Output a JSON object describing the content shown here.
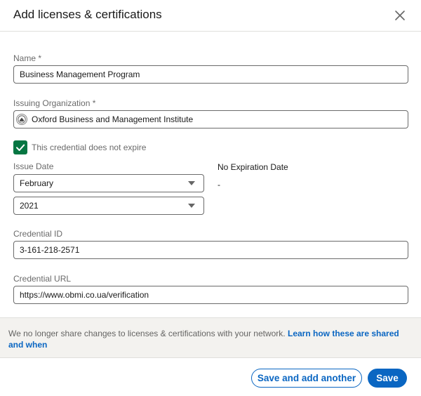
{
  "dialog": {
    "title": "Add licenses & certifications",
    "close_icon": "close-icon"
  },
  "form": {
    "name": {
      "label": "Name *",
      "value": "Business Management Program"
    },
    "issuing_org": {
      "label": "Issuing Organization *",
      "value": "Oxford Business and Management Institute",
      "logo_icon": "organization-logo-icon"
    },
    "no_expire": {
      "label": "This credential does not expire",
      "checked": true
    },
    "issue_date": {
      "label": "Issue Date",
      "month": "February",
      "year": "2021"
    },
    "expiration": {
      "label": "No Expiration Date",
      "value": "-"
    },
    "credential_id": {
      "label": "Credential ID",
      "value": "3-161-218-2571"
    },
    "credential_url": {
      "label": "Credential URL",
      "value": "https://www.obmi.co.ua/verification"
    }
  },
  "notice": {
    "text": "We no longer share changes to licenses & certifications with your network. ",
    "link": "Learn how these are shared and when"
  },
  "footer": {
    "secondary_label": "Save and add another",
    "primary_label": "Save"
  },
  "colors": {
    "accent": "#0a66c2",
    "checkbox": "#057642",
    "notice_bg": "#f3f2ef"
  }
}
